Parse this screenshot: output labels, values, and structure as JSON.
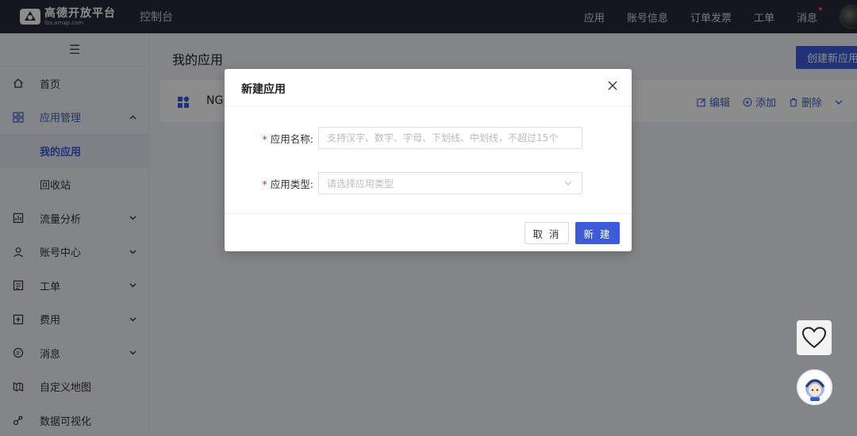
{
  "topbar": {
    "logo_name": "高德开放平台",
    "logo_domain": "lbs.amap.com",
    "console_label": "控制台",
    "nav": [
      "应用",
      "账号信息",
      "订单发票",
      "工单",
      "消息"
    ]
  },
  "sidebar": {
    "items": [
      {
        "label": "首页",
        "icon": "home-icon"
      },
      {
        "label": "应用管理",
        "icon": "grid-icon"
      },
      {
        "label": "流量分析",
        "icon": "analytics-icon"
      },
      {
        "label": "账号中心",
        "icon": "user-icon"
      },
      {
        "label": "工单",
        "icon": "ticket-icon"
      },
      {
        "label": "费用",
        "icon": "cost-icon"
      },
      {
        "label": "消息",
        "icon": "message-icon"
      },
      {
        "label": "自定义地图",
        "icon": "map-icon"
      },
      {
        "label": "数据可视化",
        "icon": "visualization-icon"
      }
    ],
    "sub_items": [
      "我的应用",
      "回收站"
    ]
  },
  "main": {
    "title": "我的应用",
    "create_button": "创建新应用",
    "app_card": {
      "name": "NG",
      "actions": [
        "编辑",
        "添加",
        "删除"
      ]
    }
  },
  "modal": {
    "title": "新建应用",
    "fields": {
      "name_label": "应用名称:",
      "name_placeholder": "支持汉字、数字、字母、下划线、中划线，不超过15个",
      "type_label": "应用类型:",
      "type_placeholder": "请选择应用类型"
    },
    "cancel_label": "取 消",
    "ok_label": "新 建"
  },
  "colors": {
    "primary": "#3d5bd9",
    "topbar_bg": "#252b3a",
    "required": "#f5222d"
  }
}
